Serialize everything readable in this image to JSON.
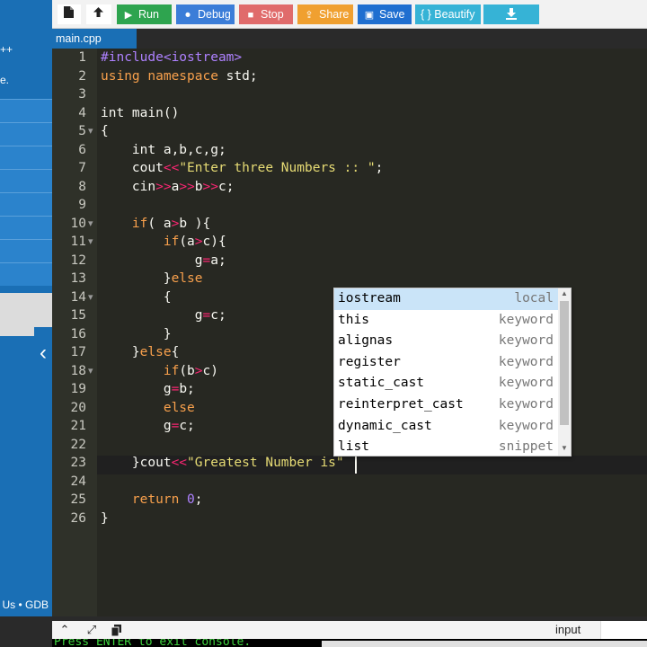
{
  "sidebar": {
    "fragments": [
      "++",
      "e."
    ],
    "footer": "Us • GDB",
    "collapse_glyph": "‹"
  },
  "toolbar": {
    "run_label": "Run",
    "debug_label": "Debug",
    "stop_label": "Stop",
    "share_label": "Share",
    "save_label": "Save",
    "beautify_label": "{ } Beautify"
  },
  "tabs": [
    {
      "label": "main.cpp"
    }
  ],
  "editor": {
    "line_numbers": [
      "1",
      "2",
      "3",
      "4",
      "5",
      "6",
      "7",
      "8",
      "9",
      "10",
      "11",
      "12",
      "13",
      "14",
      "15",
      "16",
      "17",
      "18",
      "19",
      "20",
      "21",
      "22",
      "23",
      "24",
      "25",
      "26"
    ],
    "active_line": 23
  },
  "autocomplete": {
    "items": [
      {
        "name": "iostream",
        "meta": "local"
      },
      {
        "name": "this",
        "meta": "keyword"
      },
      {
        "name": "alignas",
        "meta": "keyword"
      },
      {
        "name": "register",
        "meta": "keyword"
      },
      {
        "name": "static_cast",
        "meta": "keyword"
      },
      {
        "name": "reinterpret_cast",
        "meta": "keyword"
      },
      {
        "name": "dynamic_cast",
        "meta": "keyword"
      },
      {
        "name": "list",
        "meta": "snippet"
      }
    ]
  },
  "console": {
    "input_label": "input",
    "output_text": "Press ENTER to exit console."
  },
  "colors": {
    "editor_bg": "#272822",
    "sidebar_bg": "#1a6fb5",
    "run_green": "#2ea44f",
    "keyword_pink": "#f92672",
    "string_yellow": "#e6db74"
  }
}
